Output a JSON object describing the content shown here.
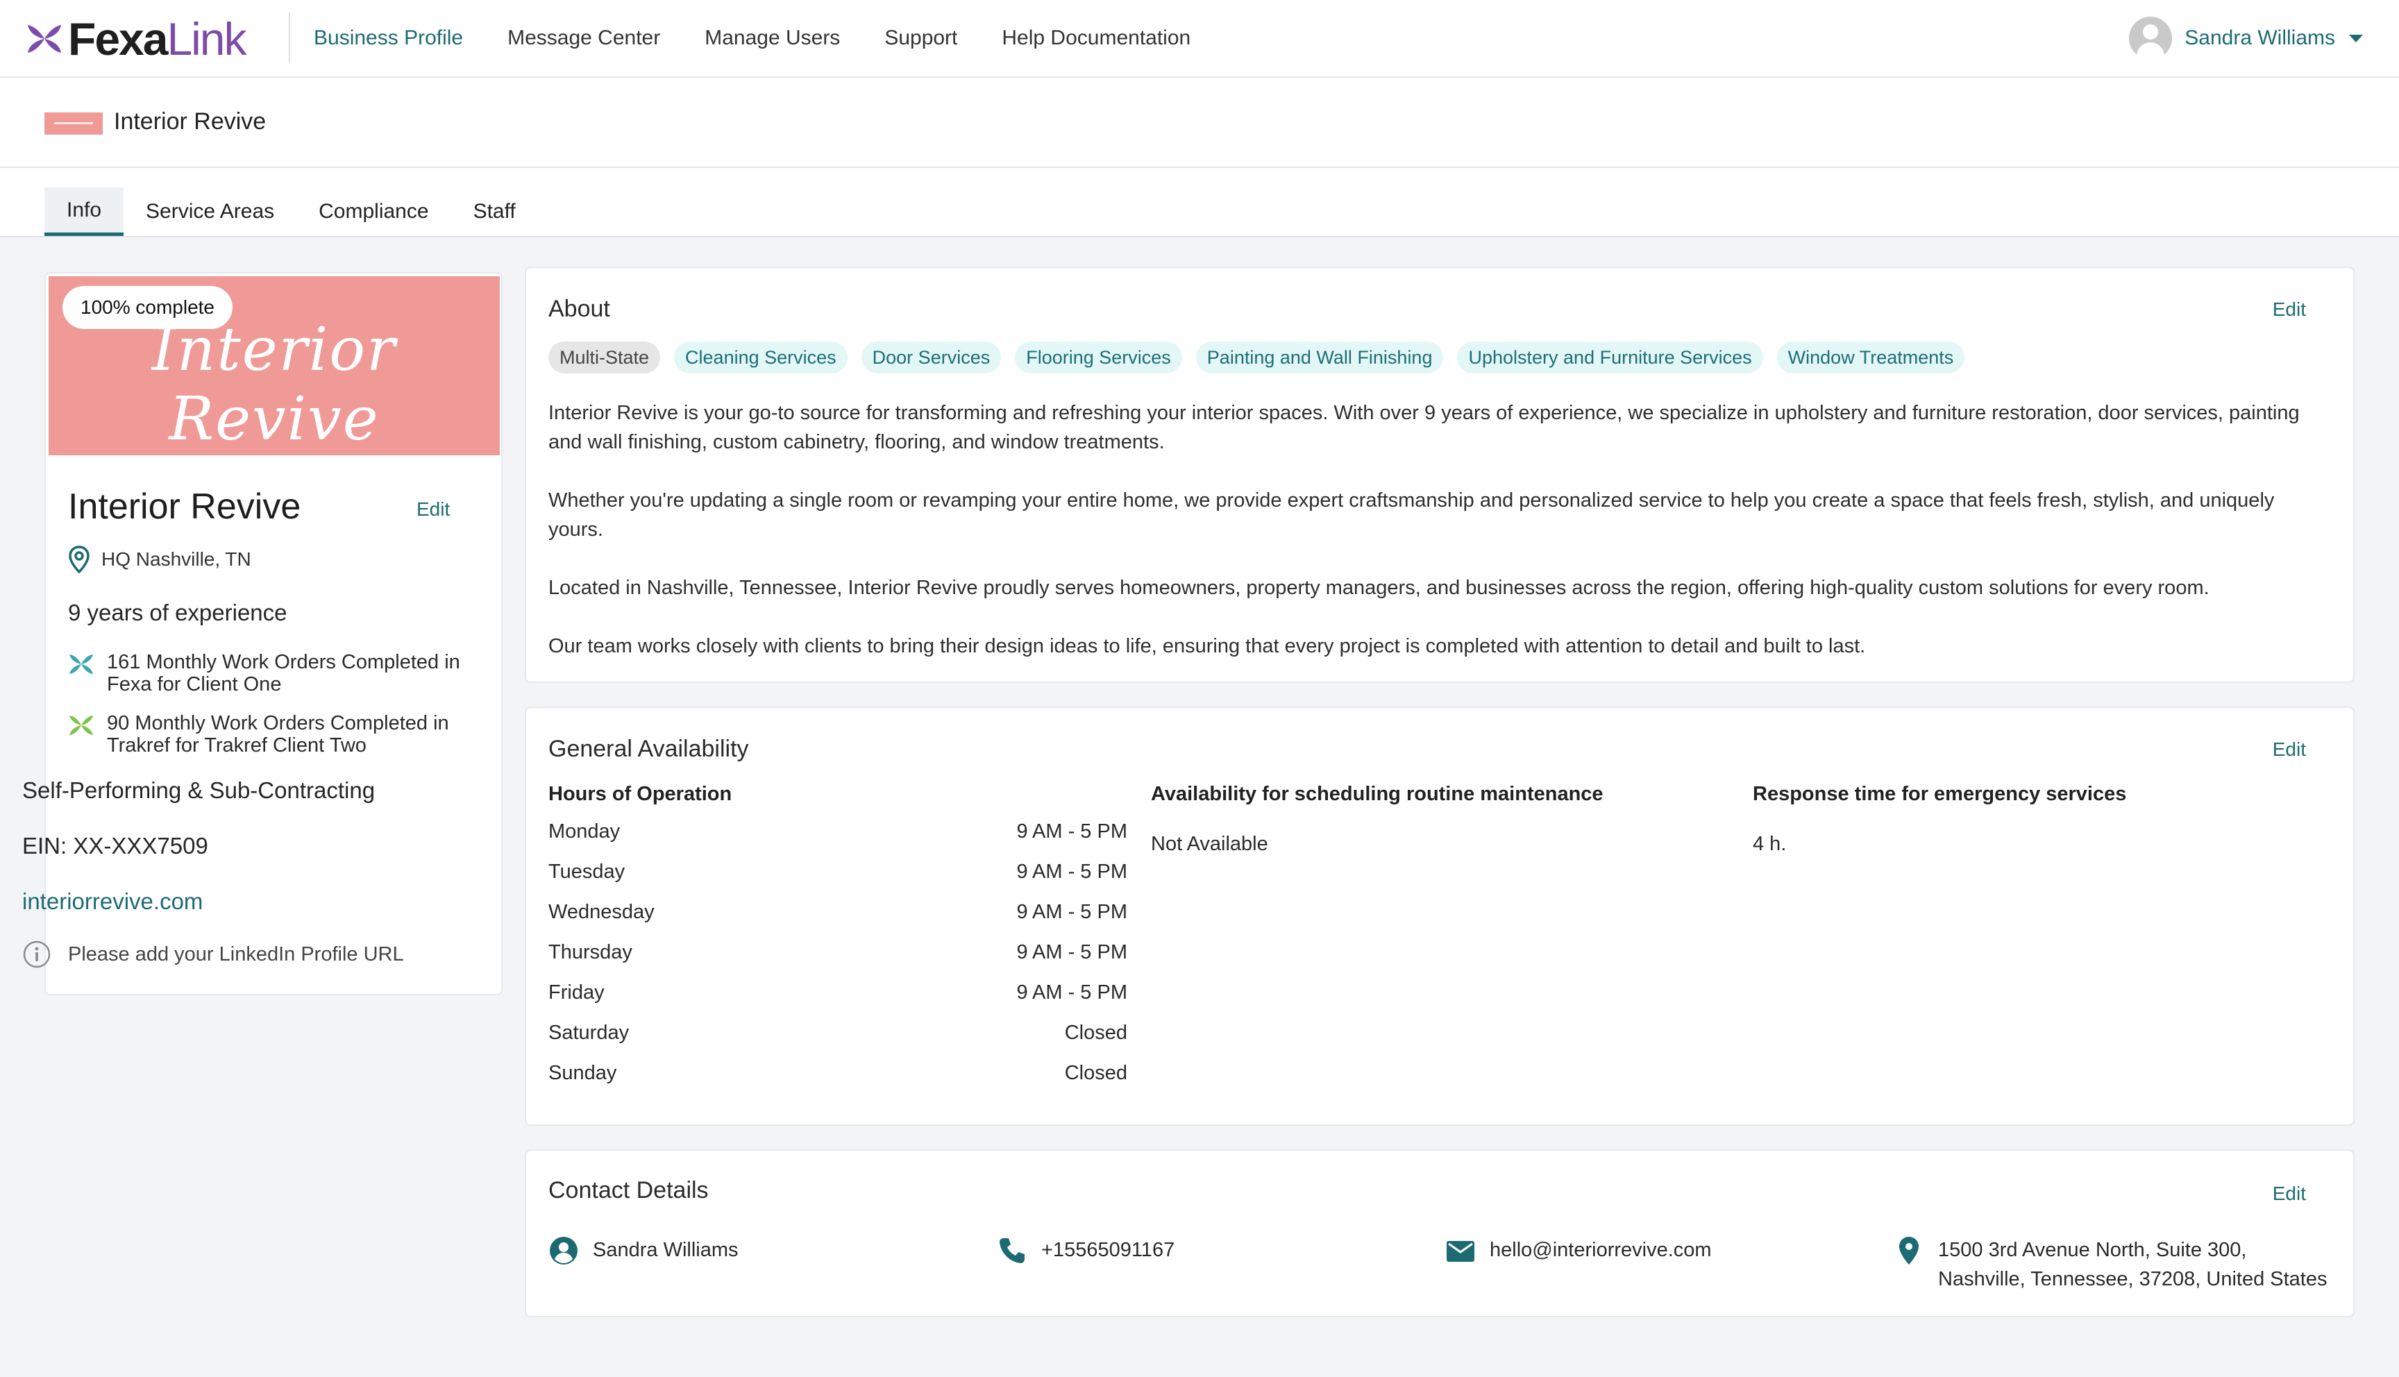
{
  "brand": {
    "logo_main": "Fexa",
    "logo_accent": "Link",
    "colors": {
      "primary": "#1c6b73",
      "logo_purple": "#7d4ca8",
      "banner": "#f09a97",
      "tag_bg": "#e4f7f7"
    }
  },
  "nav": {
    "items": [
      {
        "label": "Business Profile",
        "active": true
      },
      {
        "label": "Message Center"
      },
      {
        "label": "Manage Users"
      },
      {
        "label": "Support"
      },
      {
        "label": "Help Documentation"
      }
    ],
    "user": {
      "name": "Sandra Williams",
      "icon": "user-avatar-icon"
    }
  },
  "page": {
    "title": "Interior Revive"
  },
  "tabs": [
    {
      "label": "Info",
      "active": true
    },
    {
      "label": "Service Areas"
    },
    {
      "label": "Compliance"
    },
    {
      "label": "Staff"
    }
  ],
  "profile": {
    "completion": "100% complete",
    "banner_text": "Interior Revive",
    "name": "Interior Revive",
    "edit_label": "Edit",
    "location": "HQ Nashville, TN",
    "experience": "9 years of experience",
    "work_orders": [
      {
        "text": "161 Monthly Work Orders Completed in Fexa for Client One",
        "icon": "fexa-mark-icon"
      },
      {
        "text": "90 Monthly Work Orders Completed in Trakref for Trakref Client Two",
        "icon": "trakref-mark-icon"
      }
    ],
    "performing": "Self-Performing & Sub-Contracting",
    "ein": "EIN: XX-XXX7509",
    "website": "interiorrevive.com",
    "linkedin_prompt": "Please add your LinkedIn Profile URL"
  },
  "about": {
    "title": "About",
    "edit_label": "Edit",
    "tags": [
      {
        "label": "Multi-State",
        "style": "grey"
      },
      {
        "label": "Cleaning Services"
      },
      {
        "label": "Door Services"
      },
      {
        "label": "Flooring Services"
      },
      {
        "label": "Painting and Wall Finishing"
      },
      {
        "label": "Upholstery and Furniture Services"
      },
      {
        "label": "Window Treatments"
      }
    ],
    "paragraphs": [
      "Interior Revive is your go-to source for transforming and refreshing your interior spaces. With over 9 years of experience, we specialize in upholstery and furniture restoration, door services, painting and wall finishing, custom cabinetry, flooring, and window treatments.",
      "Whether you're updating a single room or revamping your entire home, we provide expert craftsmanship and personalized service to help you create a space that feels fresh, stylish, and uniquely yours.",
      "Located in Nashville, Tennessee, Interior Revive proudly serves homeowners, property managers, and businesses across the region, offering high-quality custom solutions for every room.",
      "Our team works closely with clients to bring their design ideas to life, ensuring that every project is completed with attention to detail and built to last."
    ]
  },
  "availability": {
    "title": "General Availability",
    "edit_label": "Edit",
    "hours_header": "Hours of Operation",
    "hours": [
      {
        "day": "Monday",
        "time": "9 AM - 5 PM"
      },
      {
        "day": "Tuesday",
        "time": "9 AM - 5 PM"
      },
      {
        "day": "Wednesday",
        "time": "9 AM - 5 PM"
      },
      {
        "day": "Thursday",
        "time": "9 AM - 5 PM"
      },
      {
        "day": "Friday",
        "time": "9 AM - 5 PM"
      },
      {
        "day": "Saturday",
        "time": "Closed"
      },
      {
        "day": "Sunday",
        "time": "Closed"
      }
    ],
    "routine_header": "Availability for scheduling routine maintenance",
    "routine_value": "Not Available",
    "emergency_header": "Response time for emergency services",
    "emergency_value": "4 h."
  },
  "contact": {
    "title": "Contact Details",
    "edit_label": "Edit",
    "name": "Sandra Williams",
    "phone": "+15565091167",
    "email": "hello@interiorrevive.com",
    "address_line1": "1500 3rd Avenue North, Suite 300,",
    "address_line2": "Nashville, Tennessee, 37208, United States"
  }
}
